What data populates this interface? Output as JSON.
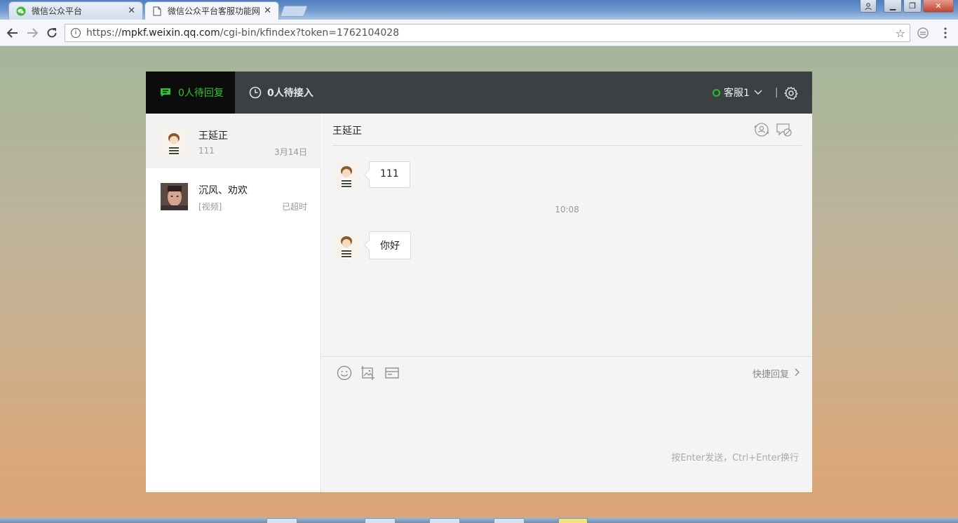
{
  "browser": {
    "tabs": [
      {
        "title": "微信公众平台",
        "active": false
      },
      {
        "title": "微信公众平台客服功能网",
        "active": true
      }
    ],
    "url_prefix": "https://",
    "url_host": "mpkf.weixin.qq.com",
    "url_path": "/cgi-bin/kfindex?token=1762104028"
  },
  "topbar": {
    "pending_label": "0人待回复",
    "waiting_label": "0人待接入",
    "agent_name": "客服1",
    "status_color": "#25c325"
  },
  "conversations": [
    {
      "name": "王延正",
      "preview": "111",
      "time": "3月14日",
      "selected": true
    },
    {
      "name": "沉风、劝欢",
      "preview": "[视频]",
      "time": "已超时",
      "selected": false
    }
  ],
  "chat": {
    "title": "王延正",
    "messages": [
      {
        "text": "111"
      },
      {
        "timestamp": "10:08"
      },
      {
        "text": "你好"
      }
    ],
    "quick_reply_label": "快捷回复",
    "input_hint": "按Enter发送，Ctrl+Enter换行"
  },
  "colors": {
    "accent_green": "#33c233",
    "topbar_bg": "#3b4043"
  }
}
